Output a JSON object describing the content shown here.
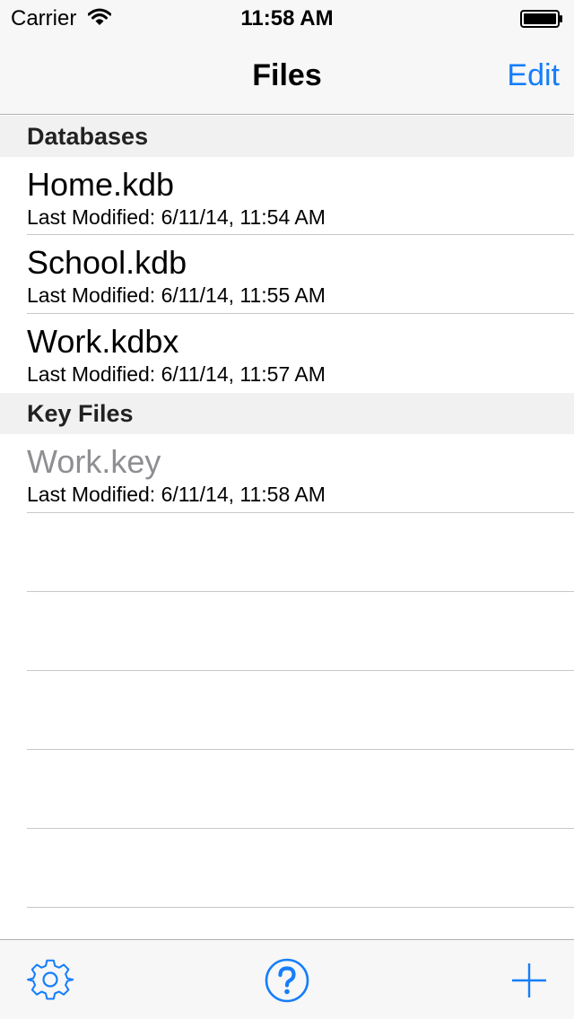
{
  "status_bar": {
    "carrier": "Carrier",
    "time": "11:58 AM"
  },
  "nav": {
    "title": "Files",
    "edit_label": "Edit"
  },
  "sections": {
    "databases": {
      "header": "Databases",
      "items": [
        {
          "title": "Home.kdb",
          "subtitle": "Last Modified: 6/11/14, 11:54 AM"
        },
        {
          "title": "School.kdb",
          "subtitle": "Last Modified: 6/11/14, 11:55 AM"
        },
        {
          "title": "Work.kdbx",
          "subtitle": "Last Modified: 6/11/14, 11:57 AM"
        }
      ]
    },
    "key_files": {
      "header": "Key Files",
      "items": [
        {
          "title": "Work.key",
          "subtitle": "Last Modified: 6/11/14, 11:58 AM"
        }
      ]
    }
  },
  "toolbar": {
    "settings_icon": "gear-icon",
    "help_icon": "question-circle-icon",
    "add_icon": "plus-icon"
  },
  "colors": {
    "accent": "#157efb",
    "bar_background": "#f7f7f7",
    "section_background": "#f1f1f1",
    "disabled_text": "#8e8e93",
    "separator": "#c8c7cc"
  }
}
